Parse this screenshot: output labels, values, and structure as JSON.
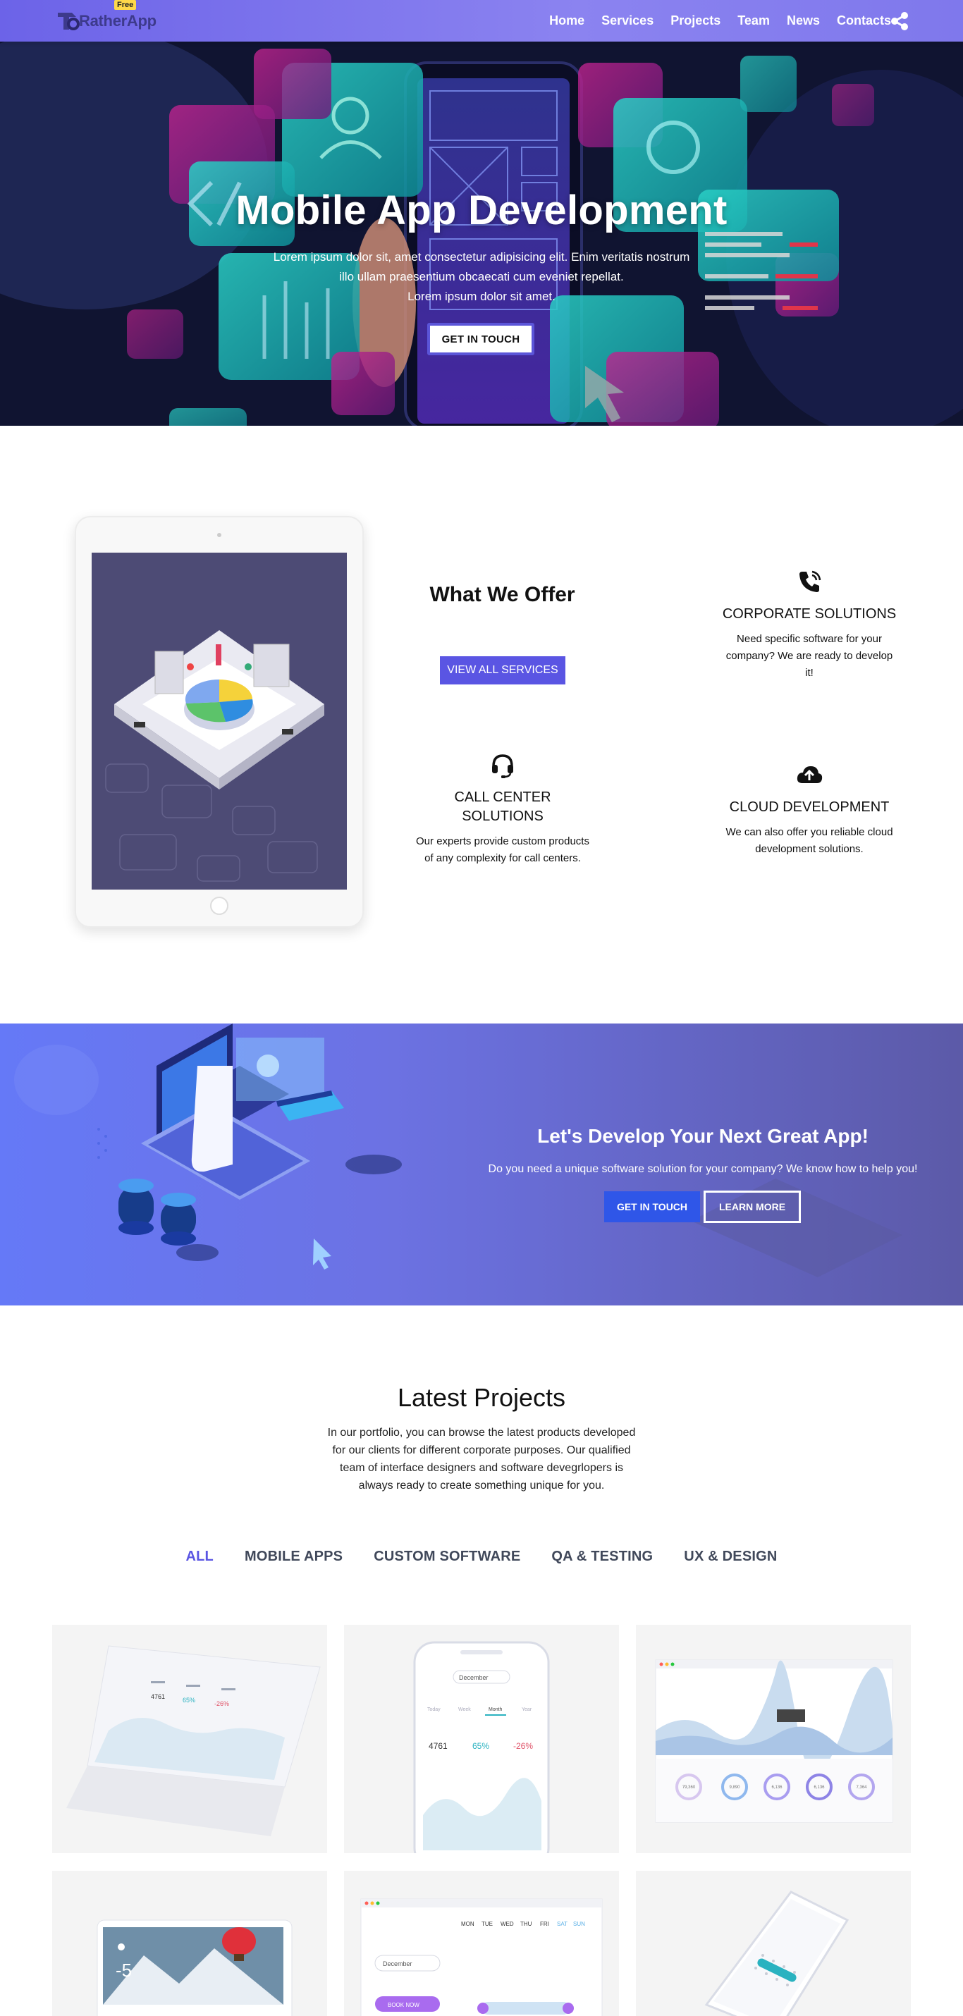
{
  "nav": {
    "brand": "RatherApp",
    "badge": "Free",
    "items": [
      "Home",
      "Services",
      "Projects",
      "Team",
      "News",
      "Contacts"
    ]
  },
  "hero": {
    "title": "Mobile App Development",
    "line1": "Lorem ipsum dolor sit, amet consectetur adipisicing elit. Enim veritatis nostrum",
    "line2": "illo ullam praesentium obcaecati cum eveniet repellat.",
    "line3": "Lorem ipsum dolor sit amet.",
    "button": "GET IN TOUCH"
  },
  "offer": {
    "title": "What We Offer",
    "button": "VIEW ALL SERVICES",
    "services": [
      {
        "icon": "phone-icon",
        "title": "CORPORATE SOLUTIONS",
        "text": "Need specific software for your company? We are ready to develop it!"
      },
      {
        "icon": "headset-icon",
        "title": "CALL CENTER SOLUTIONS",
        "text": "Our experts provide custom products of any complexity for call centers."
      },
      {
        "icon": "cloud-upload-icon",
        "title": "CLOUD DEVELOPMENT",
        "text": "We can also offer you reliable cloud development solutions."
      }
    ]
  },
  "cta": {
    "title": "Let's Develop Your Next Great App!",
    "text": "Do you need a unique software solution for your company? We know how to help you!",
    "primary": "GET IN TOUCH",
    "secondary": "LEARN MORE"
  },
  "projects": {
    "title": "Latest Projects",
    "text": "In our portfolio, you can browse the latest products developed for our clients for different corporate purposes. Our qualified team of interface designers and software devegrlopers is always ready to create something unique for you.",
    "filters": [
      "ALL",
      "MOBILE APPS",
      "CUSTOM SOFTWARE",
      "QA & TESTING",
      "UX & DESIGN"
    ],
    "active_filter": "ALL",
    "card1": {
      "v1": "4761",
      "v2": "65%",
      "v3": "-26%"
    },
    "card2": {
      "month": "December",
      "tabs": [
        "Today",
        "Week",
        "Month",
        "Year"
      ],
      "v1": "4761",
      "v2": "65%",
      "v3": "-26%"
    },
    "card3": {
      "gauges": [
        "79,360",
        "9,890",
        "6,136",
        "6,136",
        "7,364"
      ]
    },
    "card4": {
      "temp": "-5"
    },
    "card5": {
      "month": "December",
      "days": [
        "MON",
        "TUE",
        "WED",
        "THU",
        "FRI",
        "SAT",
        "SUN"
      ],
      "button": "BOOK NOW"
    }
  },
  "colors": {
    "accent": "#5a55e3",
    "nav": "#7b74ec",
    "cta_blue": "#2f56e8"
  }
}
